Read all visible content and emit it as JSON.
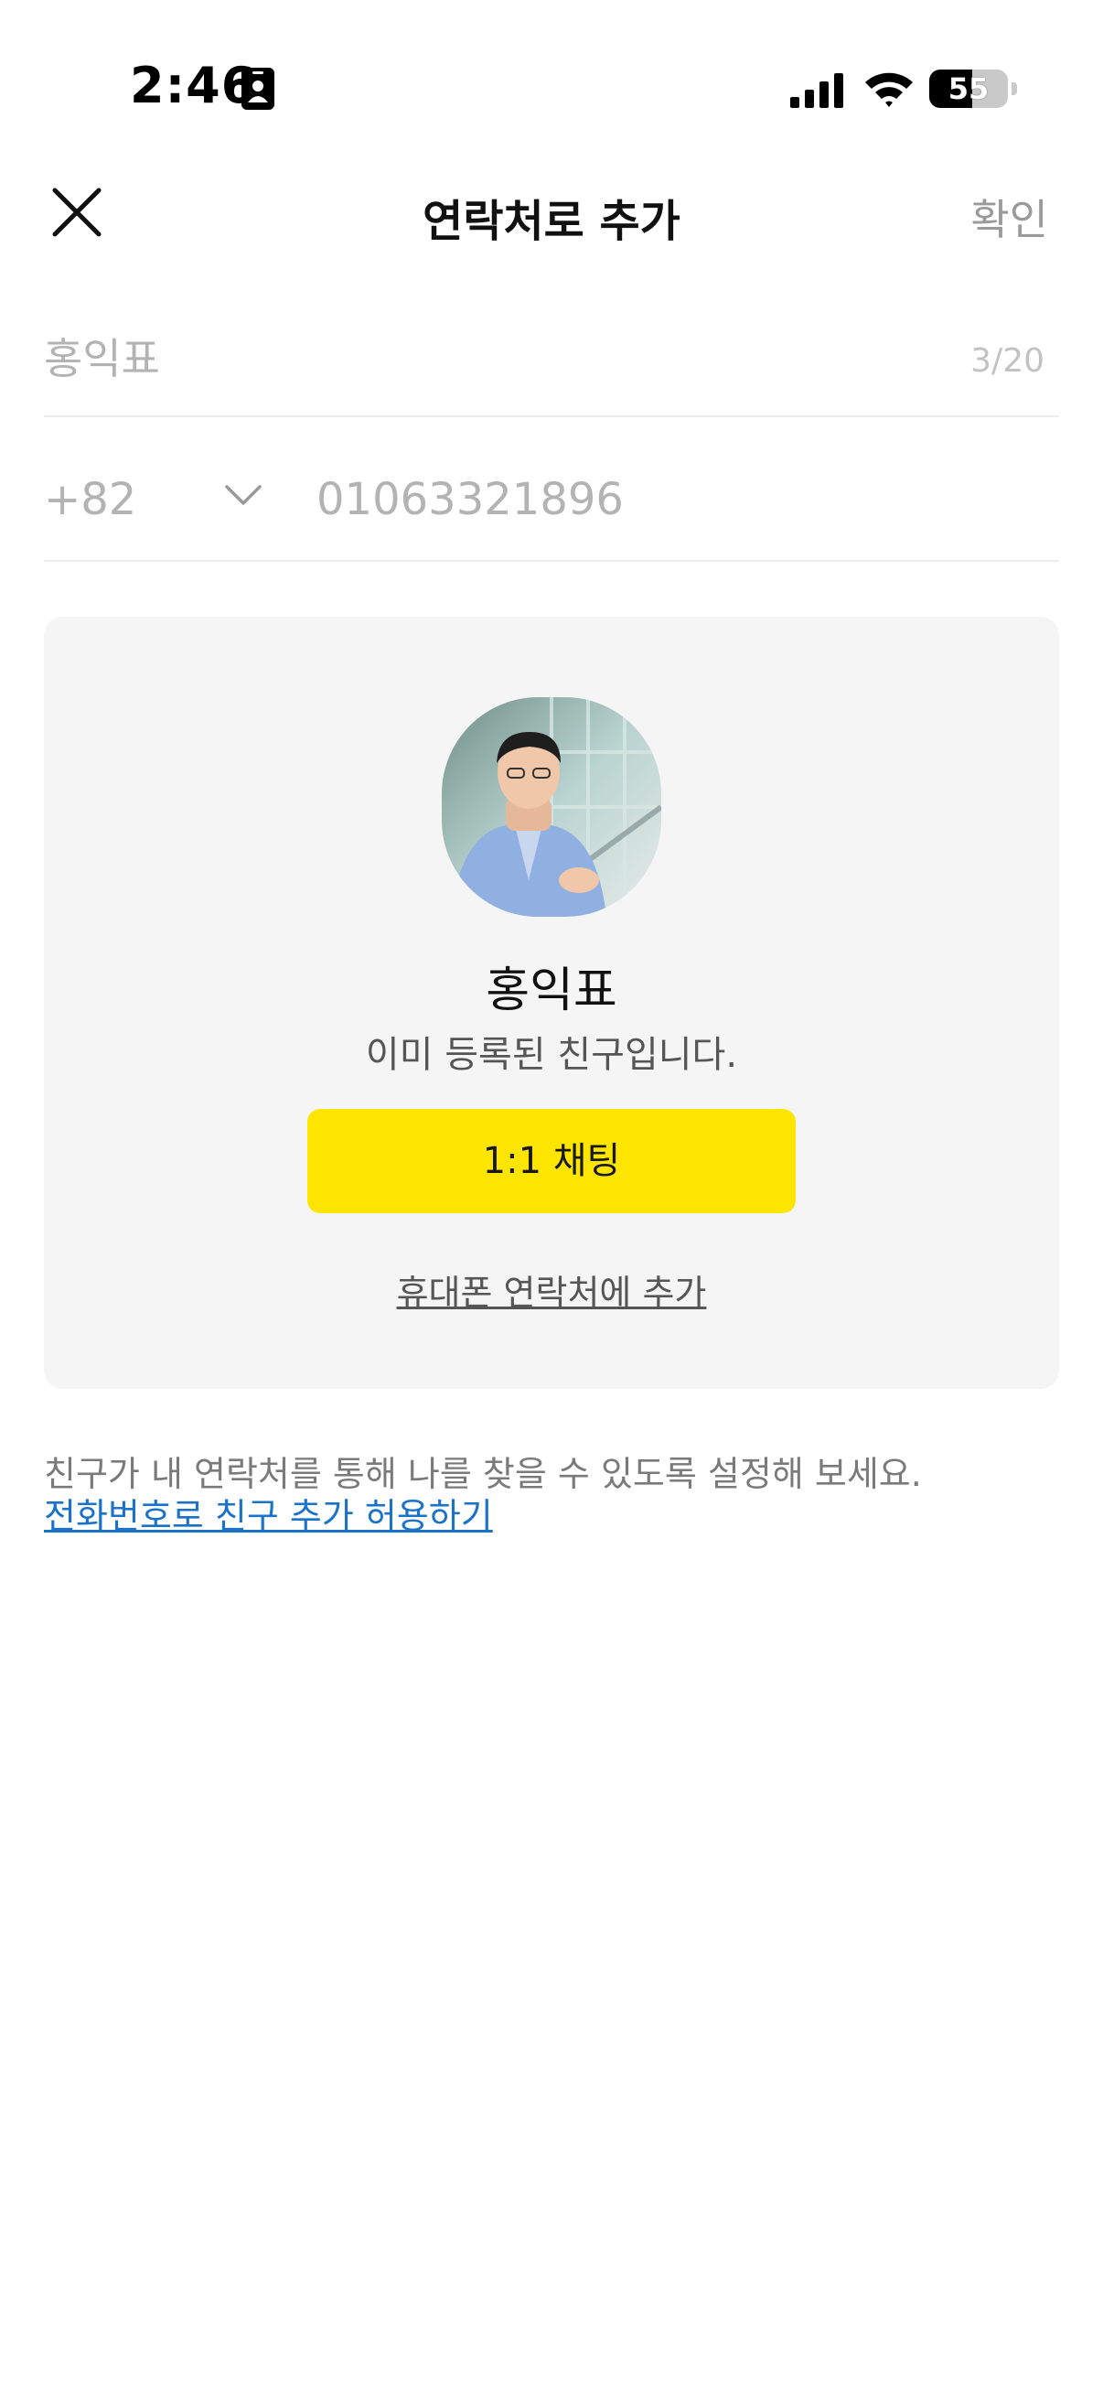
{
  "status_bar": {
    "time": "2:46",
    "battery_level": "55",
    "battery_fraction": 0.55,
    "icons": [
      "id-card-icon",
      "cellular-signal-icon",
      "wifi-icon",
      "battery-icon"
    ]
  },
  "header": {
    "title": "연락처로 추가",
    "confirm_label": "확인",
    "close_icon": "close-icon"
  },
  "name_field": {
    "value": "홍익표",
    "counter": "3/20"
  },
  "phone_field": {
    "country_code": "+82",
    "number": "01063321896",
    "dropdown_icon": "chevron-down-icon"
  },
  "friend_card": {
    "name": "홍익표",
    "status": "이미 등록된 친구입니다.",
    "chat_button": "1:1 채팅",
    "add_to_contacts_link": "휴대폰 연락처에 추가"
  },
  "footer": {
    "hint": "친구가 내 연락처를 통해 나를 찾을 수 있도록 설정해 보세요.",
    "allow_link": "전화번호로 친구 추가 허용하기"
  },
  "colors": {
    "accent_yellow": "#fee500",
    "link_blue": "#1a73c8",
    "card_bg": "#f5f5f5",
    "placeholder_gray": "#b3b3b3"
  }
}
